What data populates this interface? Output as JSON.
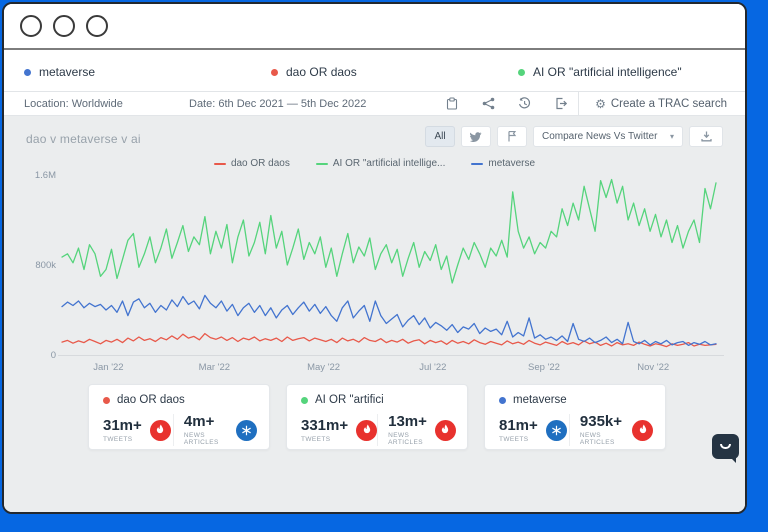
{
  "tabs": [
    {
      "label": "metaverse",
      "color": "#4374cf"
    },
    {
      "label": "dao OR daos",
      "color": "#e8594a"
    },
    {
      "label": "AI OR \"artificial intelligence\"",
      "color": "#55d47c"
    }
  ],
  "toolbar": {
    "location_label": "Location: Worldwide",
    "date_label": "Date: 6th Dec 2021 — 5th Dec 2022",
    "icons": [
      "clipboard-icon",
      "share-icon",
      "history-icon",
      "export-icon"
    ],
    "create_search_label": "Create a TRAC search"
  },
  "chart_header": {
    "title": "dao v metaverse v ai",
    "filter_all_label": "All",
    "compare_dropdown_label": "Compare News Vs Twitter"
  },
  "chart_data": {
    "type": "line",
    "title": "dao v metaverse v ai",
    "unit": "thousands",
    "ylim": [
      0,
      1600
    ],
    "grid": false,
    "legend_position": "top-center",
    "y_ticks": [
      {
        "label": "1.6M",
        "value": 1600
      },
      {
        "label": "800k",
        "value": 800
      },
      {
        "label": "0",
        "value": 0
      }
    ],
    "x_ticks": [
      {
        "label": "Jan '22",
        "pos": 0.071
      },
      {
        "label": "Mar '22",
        "pos": 0.233
      },
      {
        "label": "May '22",
        "pos": 0.4
      },
      {
        "label": "Jul '22",
        "pos": 0.567
      },
      {
        "label": "Sep '22",
        "pos": 0.737
      },
      {
        "label": "Nov '22",
        "pos": 0.904
      }
    ],
    "series": [
      {
        "name": "dao OR daos",
        "color": "#e8594a",
        "values": [
          115,
          130,
          105,
          125,
          110,
          140,
          120,
          100,
          130,
          115,
          140,
          110,
          150,
          125,
          160,
          130,
          145,
          120,
          155,
          135,
          170,
          140,
          185,
          150,
          165,
          135,
          190,
          155,
          140,
          160,
          130,
          155,
          120,
          150,
          135,
          160,
          125,
          145,
          130,
          150,
          120,
          160,
          130,
          145,
          155,
          125,
          150,
          135,
          120,
          140,
          110,
          150,
          125,
          140,
          115,
          155,
          130,
          120,
          145,
          110,
          130,
          115,
          140,
          105,
          125,
          135,
          100,
          130,
          110,
          125,
          95,
          130,
          105,
          120,
          100,
          135,
          110,
          95,
          120,
          105,
          90,
          125,
          100,
          115,
          95,
          130,
          105,
          90,
          115,
          100,
          85,
          120,
          95,
          110,
          90,
          125,
          100,
          115,
          85,
          105,
          80,
          110,
          90,
          100,
          85,
          115,
          95,
          80,
          100,
          90,
          75,
          100,
          85,
          95,
          110,
          80,
          95,
          85,
          90,
          95
        ]
      },
      {
        "name": "AI OR \"artificial intellige...",
        "color": "#55d47c",
        "values": [
          870,
          900,
          820,
          950,
          760,
          980,
          900,
          700,
          760,
          940,
          680,
          850,
          1020,
          1080,
          780,
          900,
          1050,
          820,
          950,
          1120,
          860,
          1000,
          1150,
          920,
          1050,
          980,
          1230,
          900,
          1100,
          950,
          1160,
          820,
          1050,
          1200,
          880,
          1000,
          1180,
          900,
          1240,
          950,
          1100,
          800,
          950,
          1120,
          850,
          1000,
          900,
          1050,
          780,
          950,
          700,
          900,
          1080,
          820,
          960,
          880,
          1040,
          760,
          900,
          980,
          820,
          940,
          700,
          860,
          1000,
          780,
          920,
          840,
          980,
          760,
          880,
          640,
          800,
          950,
          850,
          1000,
          900,
          780,
          950,
          880,
          1020,
          870,
          1450,
          1100,
          950,
          1050,
          900,
          1000,
          950,
          1100,
          1050,
          1300,
          1150,
          1350,
          1200,
          1500,
          1300,
          1100,
          1550,
          1400,
          1560,
          1350,
          1500,
          1200,
          1350,
          1150,
          1300,
          1100,
          1250,
          1050,
          1200,
          1000,
          1150,
          950,
          1100,
          1200,
          1000,
          1480,
          1300,
          1530
        ]
      },
      {
        "name": "metaverse",
        "color": "#4374cf",
        "values": [
          430,
          470,
          440,
          480,
          420,
          460,
          430,
          450,
          400,
          440,
          380,
          480,
          350,
          470,
          500,
          420,
          460,
          380,
          440,
          400,
          490,
          430,
          520,
          450,
          480,
          410,
          530,
          460,
          420,
          480,
          390,
          450,
          350,
          420,
          460,
          380,
          440,
          350,
          420,
          330,
          400,
          440,
          360,
          420,
          470,
          390,
          450,
          370,
          430,
          350,
          300,
          420,
          480,
          330,
          390,
          440,
          300,
          480,
          350,
          280,
          320,
          360,
          250,
          310,
          350,
          270,
          330,
          240,
          290,
          260,
          220,
          270,
          200,
          250,
          230,
          280,
          190,
          240,
          210,
          230,
          180,
          300,
          160,
          200,
          170,
          330,
          150,
          180,
          140,
          160,
          130,
          170,
          120,
          280,
          140,
          120,
          150,
          110,
          130,
          160,
          110,
          140,
          100,
          290,
          120,
          100,
          130,
          90,
          120,
          100,
          130,
          90,
          110,
          120,
          85,
          110,
          95,
          120,
          90,
          100
        ]
      }
    ]
  },
  "cards": [
    {
      "name": "dao OR daos",
      "color": "#e8594a",
      "stats": [
        {
          "value": "31m+",
          "label": "TWEETS",
          "icon": "flame-icon",
          "icon_color": "#e8322e"
        },
        {
          "value": "4m+",
          "label": "NEWS ARTICLES",
          "icon": "snowflake-icon",
          "icon_color": "#1f6fc0"
        }
      ]
    },
    {
      "name": "AI OR \"artifici",
      "color": "#55d47c",
      "stats": [
        {
          "value": "331m+",
          "label": "TWEETS",
          "icon": "flame-icon",
          "icon_color": "#e8322e"
        },
        {
          "value": "13m+",
          "label": "NEWS ARTICLES",
          "icon": "flame-icon",
          "icon_color": "#e8322e"
        }
      ]
    },
    {
      "name": "metaverse",
      "color": "#4374cf",
      "stats": [
        {
          "value": "81m+",
          "label": "TWEETS",
          "icon": "snowflake-icon",
          "icon_color": "#1f6fc0"
        },
        {
          "value": "935k+",
          "label": "NEWS ARTICLES",
          "icon": "flame-icon",
          "icon_color": "#e8322e"
        }
      ]
    }
  ],
  "colors": {
    "backdrop": "#0667e2",
    "content_bg": "#ebedee",
    "window_border": "#23282e"
  }
}
